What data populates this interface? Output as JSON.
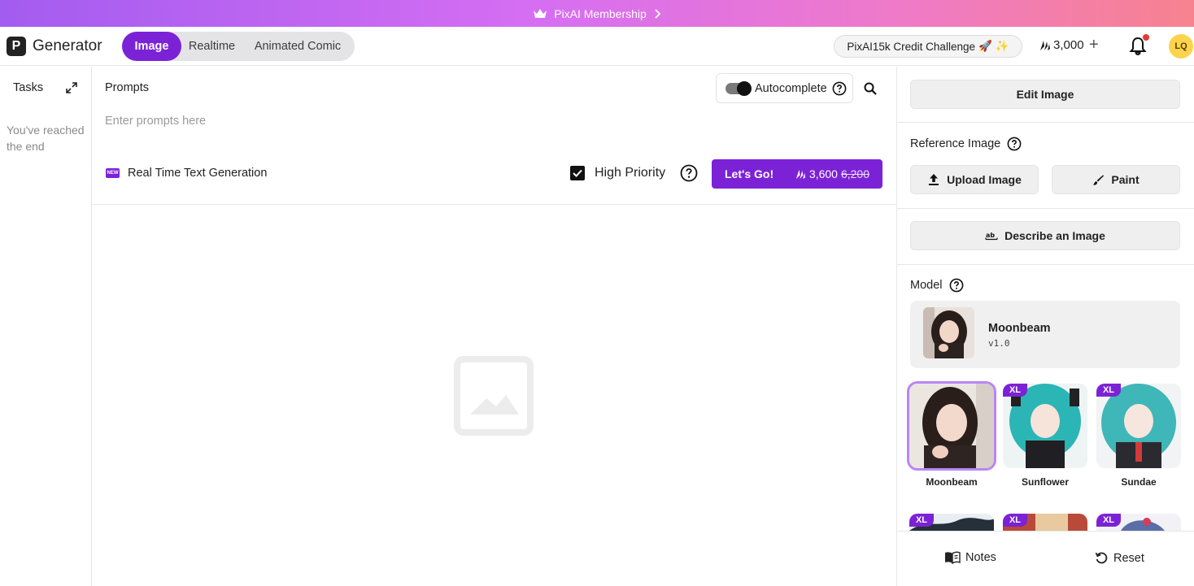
{
  "banner": {
    "text": "PixAI Membership"
  },
  "header": {
    "logo_letter": "P",
    "logo_text": "Generator",
    "tabs": [
      {
        "label": "Image",
        "active": true
      },
      {
        "label": "Realtime",
        "active": false
      },
      {
        "label": "Animated Comic",
        "active": false
      }
    ],
    "challenge": "PixAI15k Credit Challenge",
    "credits": "3,000",
    "avatar": "LQ"
  },
  "tasks": {
    "title": "Tasks",
    "end_text": "You've reached the end"
  },
  "prompt": {
    "label": "Prompts",
    "autocomplete_label": "Autocomplete",
    "placeholder": "Enter prompts here",
    "value": "",
    "new_badge": "NEW",
    "realtime_label": "Real Time Text Generation",
    "high_priority_label": "High Priority",
    "high_priority_checked": true,
    "go_label": "Let's Go!",
    "go_cost": "3,600",
    "go_cost_old": "6,200"
  },
  "right": {
    "edit_image": "Edit Image",
    "reference_label": "Reference Image",
    "upload_label": "Upload Image",
    "paint_label": "Paint",
    "describe_label": "Describe an Image",
    "model_label": "Model",
    "selected_model": {
      "name": "Moonbeam",
      "version": "v1.0"
    },
    "models": [
      {
        "name": "Moonbeam",
        "xl": false,
        "selected": true
      },
      {
        "name": "Sunflower",
        "xl": true,
        "selected": false
      },
      {
        "name": "Sundae",
        "xl": true,
        "selected": false
      }
    ],
    "models_row2_badges": [
      "XL",
      "XL",
      "XL"
    ],
    "xl_badge": "XL",
    "notes_label": "Notes",
    "reset_label": "Reset"
  },
  "colors": {
    "accent": "#7c22d6",
    "banner_start": "#a35cf0",
    "banner_end": "#f7828f"
  }
}
